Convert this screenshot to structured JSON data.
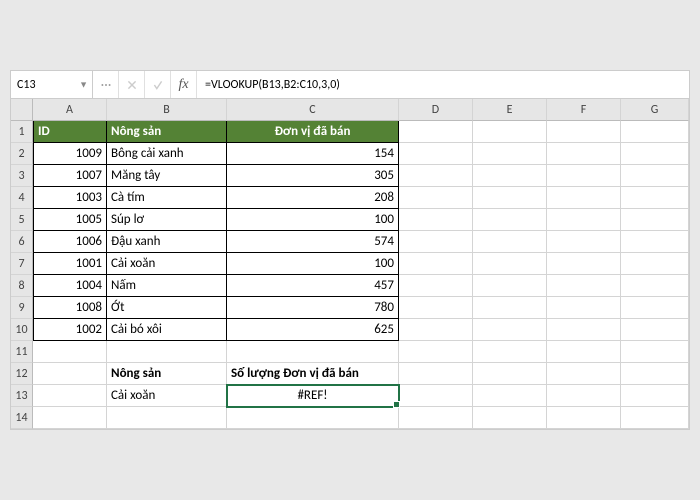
{
  "namebox": "C13",
  "formula": "=VLOOKUP(B13,B2:C10,3,0)",
  "columns": [
    "A",
    "B",
    "C",
    "D",
    "E",
    "F",
    "G"
  ],
  "rows": [
    "1",
    "2",
    "3",
    "4",
    "5",
    "6",
    "7",
    "8",
    "9",
    "10",
    "11",
    "12",
    "13",
    "14"
  ],
  "header": {
    "a": "ID",
    "b": "Nông sản",
    "c": "Đơn vị đã bán"
  },
  "data": [
    {
      "a": "1009",
      "b": "Bông cải xanh",
      "c": "154"
    },
    {
      "a": "1007",
      "b": "Măng tây",
      "c": "305"
    },
    {
      "a": "1003",
      "b": "Cà tím",
      "c": "208"
    },
    {
      "a": "1005",
      "b": "Súp lơ",
      "c": "100"
    },
    {
      "a": "1006",
      "b": "Đậu xanh",
      "c": "574"
    },
    {
      "a": "1001",
      "b": "Cải xoăn",
      "c": "100"
    },
    {
      "a": "1004",
      "b": "Nấm",
      "c": "457"
    },
    {
      "a": "1008",
      "b": "Ớt",
      "c": "780"
    },
    {
      "a": "1002",
      "b": "Cải bó xôi",
      "c": "625"
    }
  ],
  "lookup": {
    "labelB": "Nông sản",
    "labelC": "Số lượng Đơn vị đã bán",
    "valueB": "Cải xoăn",
    "valueC": "#REF!"
  }
}
